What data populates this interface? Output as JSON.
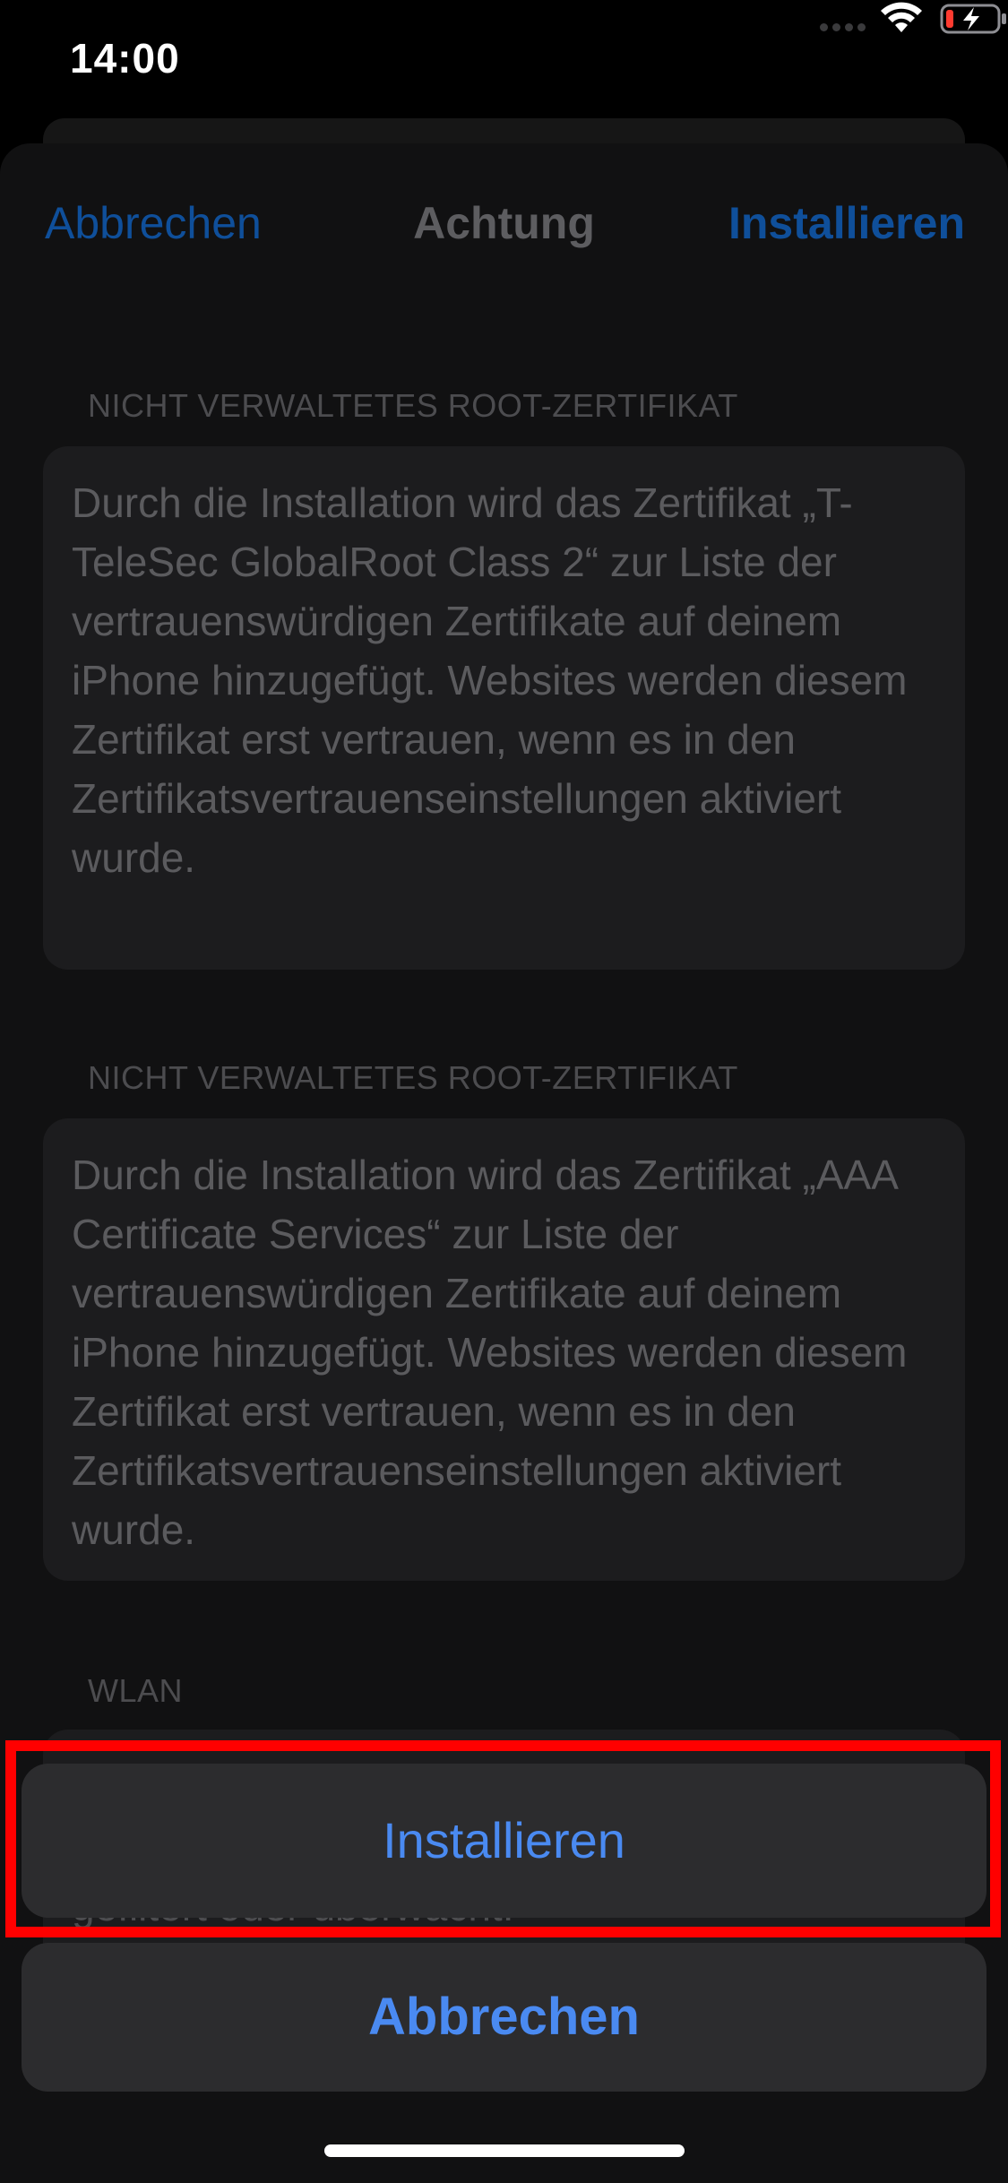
{
  "status_bar": {
    "time": "14:00",
    "icons": [
      "cellular-dots-icon",
      "wifi-icon",
      "battery-charging-icon"
    ],
    "battery_color": "#ff3b30"
  },
  "nav": {
    "cancel_label": "Abbrechen",
    "title": "Achtung",
    "install_label": "Installieren"
  },
  "sections": [
    {
      "header": "NICHT VERWALTETES ROOT-ZERTIFIKAT",
      "body": "Durch die Installation wird das Zertifikat „T-TeleSec GlobalRoot Class 2“ zur Liste der vertrauenswürdigen Zertifikate auf deinem iPhone hinzugefügt. Websites werden diesem Zertifikat erst vertrauen, wenn es in den Zertifikatsvertrauenseinstellungen aktiviert wurde."
    },
    {
      "header": "NICHT VERWALTETES ROOT-ZERTIFIKAT",
      "body": "Durch die Installation wird das Zertifikat „AAA Certificate Services“ zur Liste der vertrauenswürdigen Zertifikate auf deinem iPhone hinzugefügt. Websites werden diesem Zertifikat erst vertrauen, wenn es in den Zertifikatsvertrauenseinstellungen aktiviert wurde."
    },
    {
      "header": "WLAN",
      "body": "gefiltert oder überwacht."
    }
  ],
  "action_sheet": {
    "install_label": "Installieren",
    "cancel_label": "Abbrechen"
  },
  "colors": {
    "accent": "#4a8af1",
    "highlight": "#ff0000"
  }
}
